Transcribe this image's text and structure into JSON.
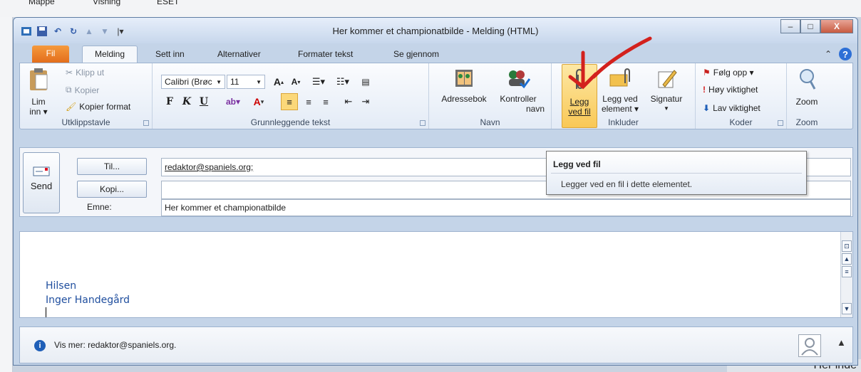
{
  "background": {
    "top_left_labels": [
      "Mappe",
      "Visning",
      "ESET"
    ],
    "bottom_right_text": "Her inde"
  },
  "window": {
    "title": "Her kommer et championatbilde - Melding (HTML)",
    "controls": {
      "minimize": "–",
      "maximize": "□",
      "close": "X"
    }
  },
  "tabs": {
    "file": "Fil",
    "active": "Melding",
    "others": [
      "Sett inn",
      "Alternativer",
      "Formater tekst",
      "Se gjennom"
    ]
  },
  "ribbon": {
    "clipboard": {
      "paste_label": "Lim inn ▾",
      "cut": "Klipp ut",
      "copy": "Kopier",
      "format_painter": "Kopier format",
      "group_label": "Utklippstavle"
    },
    "basic_text": {
      "font_name": "Calibri (Brøc",
      "font_size": "11",
      "bold": "F",
      "italic": "K",
      "underline": "U",
      "group_label": "Grunnleggende tekst"
    },
    "names": {
      "address_book": "Adressebok",
      "check_names_line1": "Kontroller",
      "check_names_line2": "navn",
      "group_label": "Navn"
    },
    "include": {
      "attach_file_line1": "Legg",
      "attach_file_line2": "ved fil",
      "attach_item_line1": "Legg ved",
      "attach_item_line2": "element ▾",
      "signature": "Signatur",
      "group_label": "Inkluder"
    },
    "tags": {
      "follow_up": "Følg opp ▾",
      "high_importance": "Høy viktighet",
      "low_importance": "Lav viktighet",
      "group_label": "Koder"
    },
    "zoom": {
      "zoom": "Zoom",
      "group_label": "Zoom"
    }
  },
  "tooltip": {
    "title": "Legg ved fil",
    "body": "Legger ved en fil i dette elementet."
  },
  "compose": {
    "send": "Send",
    "to_button": "Til...",
    "cc_button": "Kopi...",
    "subject_label": "Emne:",
    "to_value": "redaktor@spaniels.org;",
    "cc_value": "",
    "subject_value": "Her kommer et championatbilde"
  },
  "body": {
    "line1": "Hilsen",
    "line2": "Inger Handegård"
  },
  "people_pane": {
    "text": "Vis mer: redaktor@spaniels.org."
  },
  "colors": {
    "file_tab": "#e36d1c",
    "highlight": "#f9c856",
    "annotation_arrow": "#d3211d"
  }
}
